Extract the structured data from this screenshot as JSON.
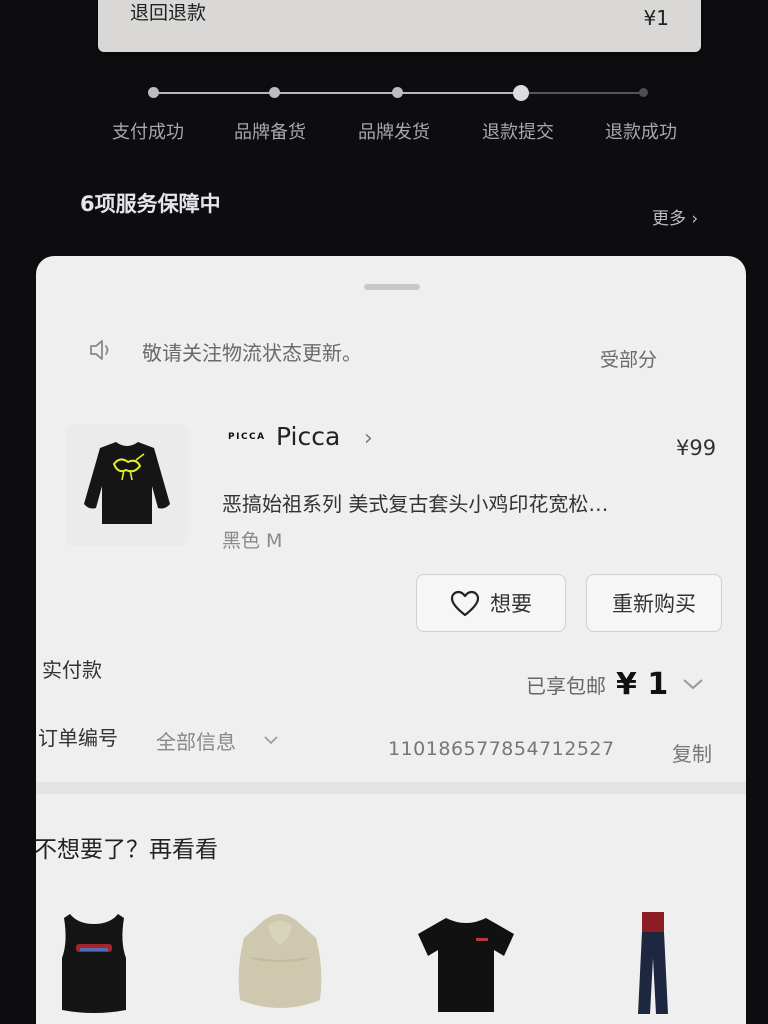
{
  "refund": {
    "label": "退回退款",
    "amount": "¥1"
  },
  "progress": {
    "steps": [
      "支付成功",
      "品牌备货",
      "品牌发货",
      "退款提交",
      "退款成功"
    ],
    "current_index": 3
  },
  "services": {
    "title": "6项服务保障中",
    "more": "更多 ›"
  },
  "notice": {
    "text": "敬请关注物流状态更新。",
    "trailing": "受部分"
  },
  "product": {
    "brand_logo": "PICCA",
    "brand": "Picca",
    "price": "¥99",
    "title": "恶搞始祖系列 美式复古套头小鸡印花宽松…",
    "variant": "黑色 M",
    "thumb_icon": "black-sweatshirt-image"
  },
  "actions": {
    "want": "想要",
    "rebuy": "重新购买"
  },
  "payment": {
    "label": "实付款",
    "shipping": "已享包邮",
    "amount": "¥ 1"
  },
  "order": {
    "label": "订单编号",
    "info": "全部信息",
    "number": "1101865778547125​27",
    "copy": "复制"
  },
  "recommend": {
    "title": "不想要了？再看看",
    "items": [
      {
        "icon": "black-tank-top-image"
      },
      {
        "icon": "light-hoodie-image"
      },
      {
        "icon": "black-tshirt-image"
      },
      {
        "icon": "flared-jeans-image"
      }
    ]
  },
  "colors": {
    "background": "#0d0d10",
    "sheet": "#efefef",
    "print_accent": "#e3ef2a"
  }
}
